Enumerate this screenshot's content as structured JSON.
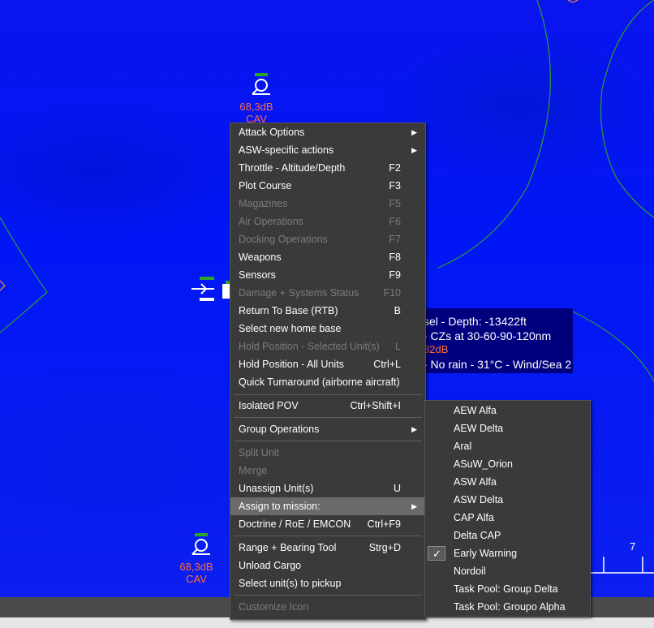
{
  "units": [
    {
      "db": "68,3dB",
      "type": "CAV"
    },
    {
      "db": "68,3dB",
      "type": "CAV"
    }
  ],
  "tooltip": {
    "line1": "sel - Depth: -13422ft",
    "line2": "- CZs at 30-60-90-120nm",
    "line3": "- No rain - 31°C - Wind/Sea 2",
    "partial_db": "82dB"
  },
  "context_menu": {
    "items": [
      {
        "label": "Attack Options",
        "shortcut": "",
        "submenu": true,
        "disabled": false
      },
      {
        "label": "ASW-specific actions",
        "shortcut": "",
        "submenu": true,
        "disabled": false
      },
      {
        "label": "Throttle - Altitude/Depth",
        "shortcut": "F2",
        "disabled": false
      },
      {
        "label": "Plot Course",
        "shortcut": "F3",
        "disabled": false
      },
      {
        "label": "Magazines",
        "shortcut": "F5",
        "disabled": true
      },
      {
        "label": "Air Operations",
        "shortcut": "F6",
        "disabled": true
      },
      {
        "label": "Docking Operations",
        "shortcut": "F7",
        "disabled": true
      },
      {
        "label": "Weapons",
        "shortcut": "F8",
        "disabled": false
      },
      {
        "label": "Sensors",
        "shortcut": "F9",
        "disabled": false
      },
      {
        "label": "Damage + Systems Status",
        "shortcut": "F10",
        "disabled": true
      },
      {
        "label": "Return To Base (RTB)",
        "shortcut": "B",
        "disabled": false
      },
      {
        "label": "Select new home base",
        "shortcut": "",
        "disabled": false
      },
      {
        "label": "Hold Position - Selected Unit(s)",
        "shortcut": "L",
        "disabled": true
      },
      {
        "label": "Hold Position - All Units",
        "shortcut": "Ctrl+L",
        "disabled": false
      },
      {
        "label": "Quick Turnaround (airborne aircraft)",
        "shortcut": "",
        "disabled": false
      },
      {
        "label": "Isolated POV",
        "shortcut": "Ctrl+Shift+I",
        "disabled": false
      },
      {
        "label": "Group Operations",
        "shortcut": "",
        "submenu": true,
        "disabled": false
      },
      {
        "label": "Split Unit",
        "shortcut": "",
        "disabled": true
      },
      {
        "label": "Merge",
        "shortcut": "",
        "disabled": true
      },
      {
        "label": "Unassign Unit(s)",
        "shortcut": "U",
        "disabled": false
      },
      {
        "label": "Assign to mission:",
        "shortcut": "",
        "submenu": true,
        "disabled": false,
        "highlighted": true
      },
      {
        "label": "Doctrine / RoE / EMCON",
        "shortcut": "Ctrl+F9",
        "disabled": false
      },
      {
        "label": "Range + Bearing Tool",
        "shortcut": "Strg+D",
        "disabled": false
      },
      {
        "label": "Unload Cargo",
        "shortcut": "",
        "disabled": false
      },
      {
        "label": "Select unit(s) to pickup",
        "shortcut": "",
        "disabled": false
      },
      {
        "label": "Customize Icon",
        "shortcut": "",
        "disabled": true
      }
    ]
  },
  "mission_submenu": {
    "items": [
      {
        "label": "AEW Alfa",
        "checked": false
      },
      {
        "label": "AEW Delta",
        "checked": false
      },
      {
        "label": "Aral",
        "checked": false
      },
      {
        "label": "ASuW_Orion",
        "checked": false
      },
      {
        "label": "ASW Alfa",
        "checked": false
      },
      {
        "label": "ASW Delta",
        "checked": false
      },
      {
        "label": "CAP Alfa",
        "checked": false
      },
      {
        "label": "Delta CAP",
        "checked": false
      },
      {
        "label": "Early Warning",
        "checked": true
      },
      {
        "label": "Nordoil",
        "checked": false
      },
      {
        "label": "Task Pool: Group Delta",
        "checked": false
      },
      {
        "label": "Task Pool: Groupo Alpha",
        "checked": false
      }
    ]
  },
  "scale": {
    "value": "7"
  },
  "colors": {
    "ocean": "#0016f5",
    "menu_bg": "#3a3a3a",
    "menu_highlight": "#6a6a6a",
    "unit_label": "#ff6b3d",
    "range_ring": "#2e9a3a",
    "tooltip_bg": "#00007e"
  }
}
